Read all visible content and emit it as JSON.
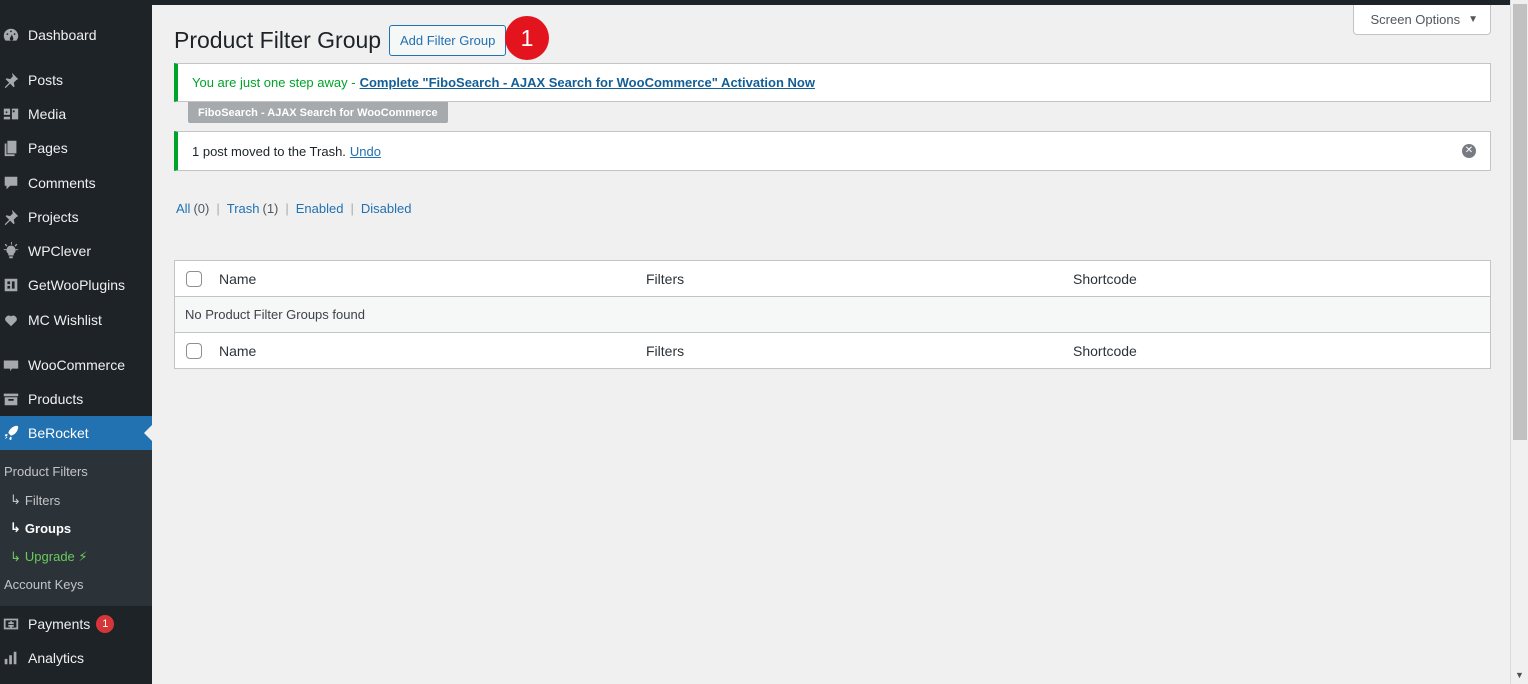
{
  "sidebar": {
    "items": [
      {
        "label": "Dashboard",
        "icon": "dashboard-icon"
      },
      {
        "label": "Posts",
        "icon": "pin-icon"
      },
      {
        "label": "Media",
        "icon": "media-icon"
      },
      {
        "label": "Pages",
        "icon": "pages-icon"
      },
      {
        "label": "Comments",
        "icon": "comments-icon"
      },
      {
        "label": "Projects",
        "icon": "pin-icon"
      },
      {
        "label": "WPClever",
        "icon": "lightbulb-icon"
      },
      {
        "label": "GetWooPlugins",
        "icon": "plugin-icon"
      },
      {
        "label": "MC Wishlist",
        "icon": "heart-icon"
      },
      {
        "label": "WooCommerce",
        "icon": "woo-icon"
      },
      {
        "label": "Products",
        "icon": "archive-icon"
      },
      {
        "label": "BeRocket",
        "icon": "rocket-icon"
      }
    ],
    "submenu": {
      "heading": "Product Filters",
      "filters": "Filters",
      "groups": "Groups",
      "upgrade": "Upgrade ⚡",
      "account_keys": "Account Keys"
    },
    "payments": {
      "label": "Payments",
      "badge": "1"
    },
    "analytics": {
      "label": "Analytics"
    }
  },
  "header": {
    "screen_options": "Screen Options",
    "title": "Product Filter Group",
    "add_button": "Add Filter Group",
    "step_marker": "1"
  },
  "notices": {
    "fibo": {
      "text": "You are just one step away -",
      "link": "Complete \"FiboSearch - AJAX Search for WooCommerce\" Activation Now",
      "tag": "FiboSearch - AJAX Search for WooCommerce"
    },
    "trash": {
      "text": "1 post moved to the Trash.",
      "link": "Undo"
    }
  },
  "views": {
    "all": "All",
    "all_count": "(0)",
    "trash": "Trash",
    "trash_count": "(1)",
    "enabled": "Enabled",
    "disabled": "Disabled",
    "separator": "|"
  },
  "table": {
    "columns": {
      "name": "Name",
      "filters": "Filters",
      "shortcode": "Shortcode"
    },
    "empty": "No Product Filter Groups found"
  },
  "colors": {
    "sidebar_bg": "#1d2327",
    "accent": "#2271b1",
    "success": "#00a32a",
    "marker": "#e3141d"
  }
}
